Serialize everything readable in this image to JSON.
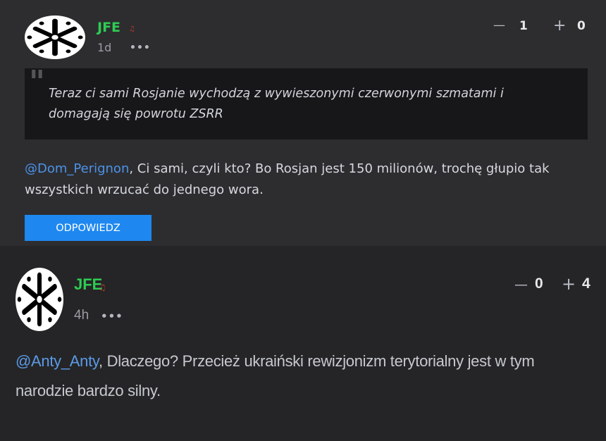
{
  "comments": [
    {
      "username": "JFE",
      "badge": "♫",
      "time": "1d",
      "more": "•••",
      "downvote_icon": "—",
      "downvotes": "1",
      "upvote_icon": "+",
      "upvotes": "0",
      "quote_mark": "\"",
      "quote": "Teraz ci sami Rosjanie wychodzą z wywieszonymi czerwonymi szmatami i domagają się powrotu ZSRR",
      "mention": "@Dom_Perignon",
      "text": ", Ci sami, czyli kto? Bo Rosjan jest 150 milionów, trochę głupio tak wszystkich wrzucać do jednego wora.",
      "reply_label": "ODPOWIEDZ"
    },
    {
      "username": "JFE",
      "badge": "♫",
      "time": "4h",
      "more": "•••",
      "downvote_icon": "—",
      "downvotes": "0",
      "upvote_icon": "+",
      "upvotes": "4",
      "mention": "@Anty_Anty",
      "text": ", Dlaczego? Przecież ukraiński rewizjonizm terytorialny jest w tym narodzie bardzo silny."
    }
  ],
  "colors": {
    "username": "#2ecc52",
    "mention": "#4c92e8",
    "reply_button": "#1e88f0",
    "background_top": "#2d2d30",
    "background_bottom": "#252527"
  },
  "icons": {
    "avatar": "white-emblem-avatar-icon",
    "badge": "music-note-icon",
    "more": "more-dots-icon",
    "downvote": "minus-icon",
    "upvote": "plus-icon"
  }
}
